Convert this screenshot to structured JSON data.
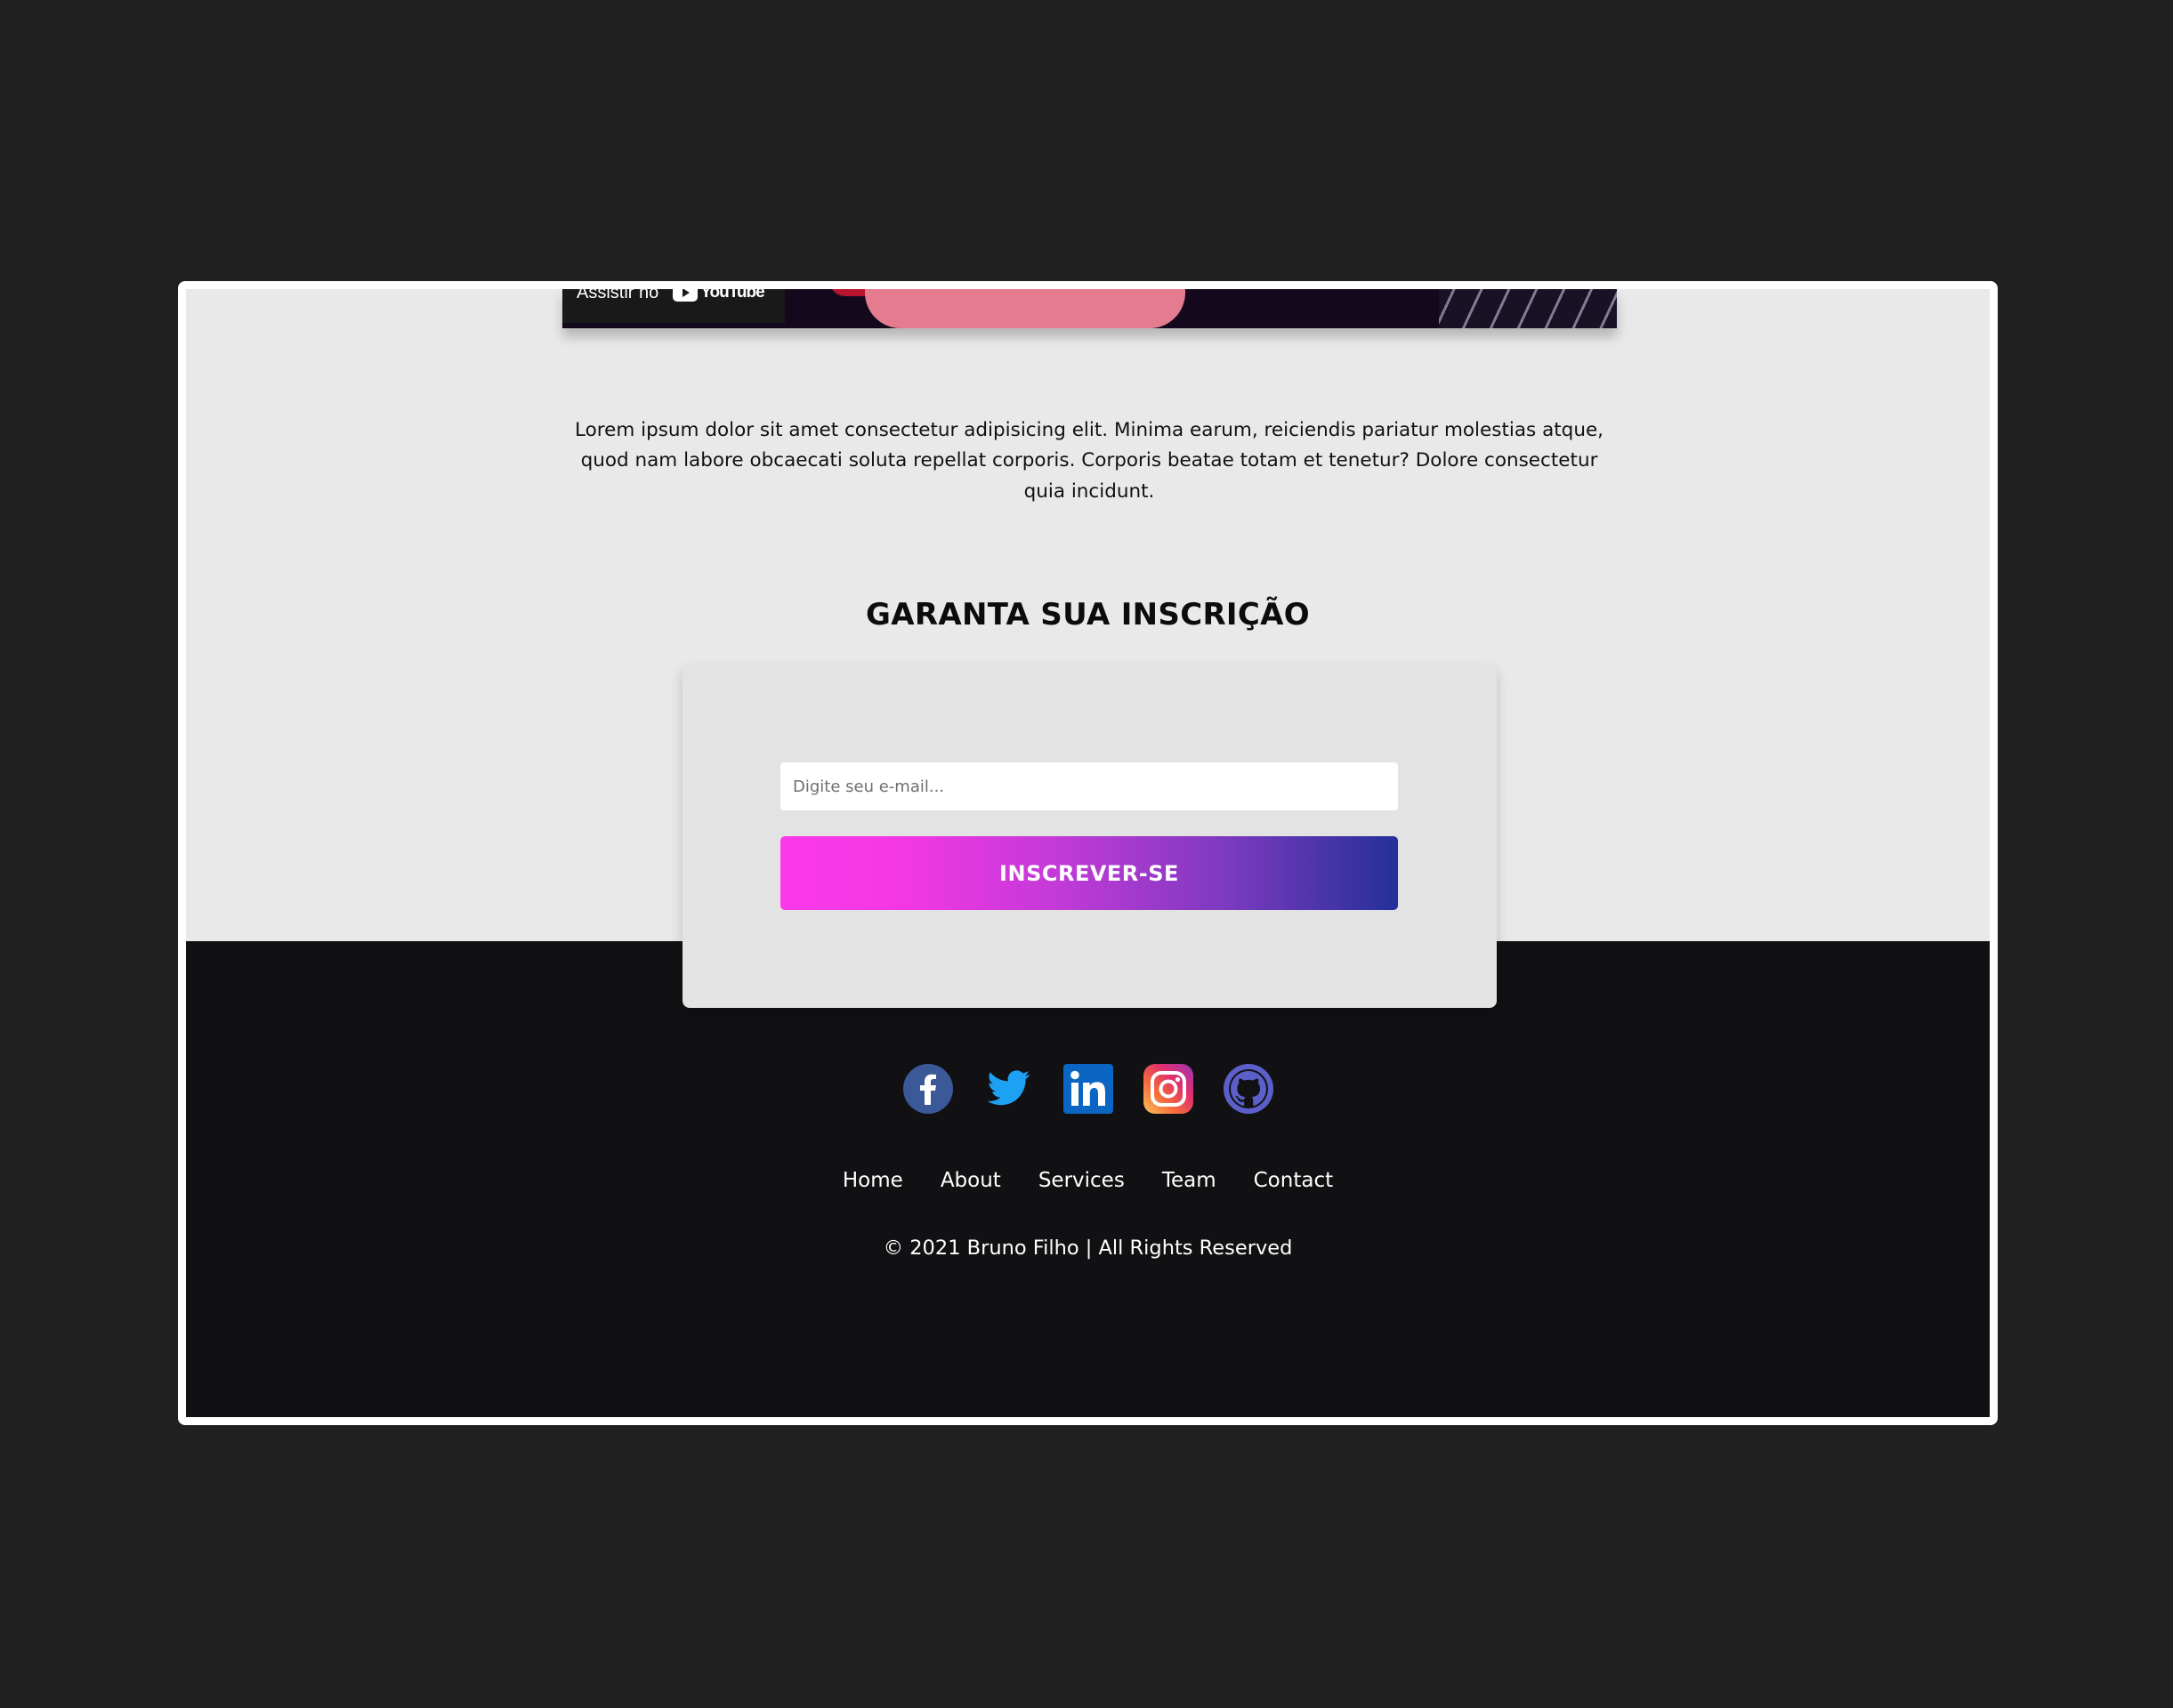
{
  "video": {
    "watch_label": "Assistir no",
    "youtube_label": "YouTube"
  },
  "intro": {
    "paragraph": "Lorem ipsum dolor sit amet consectetur adipisicing elit. Minima earum, reiciendis pariatur molestias atque, quod nam labore obcaecati soluta repellat corporis. Corporis beatae totam et tenetur? Dolore consectetur quia incidunt."
  },
  "signup": {
    "title": "GARANTA SUA INSCRIÇÃO",
    "email_placeholder": "Digite seu e-mail...",
    "email_value": "",
    "button_label": "INSCREVER-SE",
    "button_gradient": [
      "#fb3aeb",
      "#24309a"
    ]
  },
  "footer": {
    "social": [
      {
        "name": "facebook-icon",
        "color": "#3b5998"
      },
      {
        "name": "twitter-icon",
        "color": "#1da1f2"
      },
      {
        "name": "linkedin-icon",
        "color": "#0a66c2"
      },
      {
        "name": "instagram-icon",
        "color": "#e1306c"
      },
      {
        "name": "github-icon",
        "color": "#5b5fc7"
      }
    ],
    "nav": [
      "Home",
      "About",
      "Services",
      "Team",
      "Contact"
    ],
    "copyright": "© 2021 Bruno Filho | All Rights Reserved"
  },
  "colors": {
    "page_background": "#202020",
    "content_background": "#e9e9e9",
    "footer_background": "#111114",
    "card_background": "#e3e3e3"
  }
}
